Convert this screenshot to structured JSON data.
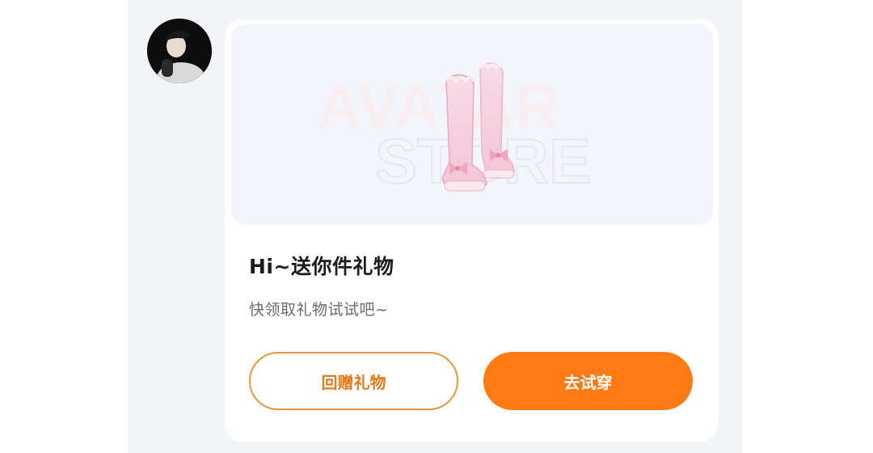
{
  "message": {
    "avatar_icon": "user-avatar",
    "gift_card": {
      "preview_watermark_lines": [
        "AVATAR",
        "STORE"
      ],
      "item_icon": "pink-boots-item",
      "title": "Hi~送你件礼物",
      "subtitle": "快领取礼物试试吧~",
      "buttons": {
        "return_gift_label": "回赠礼物",
        "try_on_label": "去试穿"
      }
    }
  },
  "colors": {
    "accent": "#ff7a14",
    "outline": "#e8963a",
    "chat_background": "#f3f4f8"
  }
}
